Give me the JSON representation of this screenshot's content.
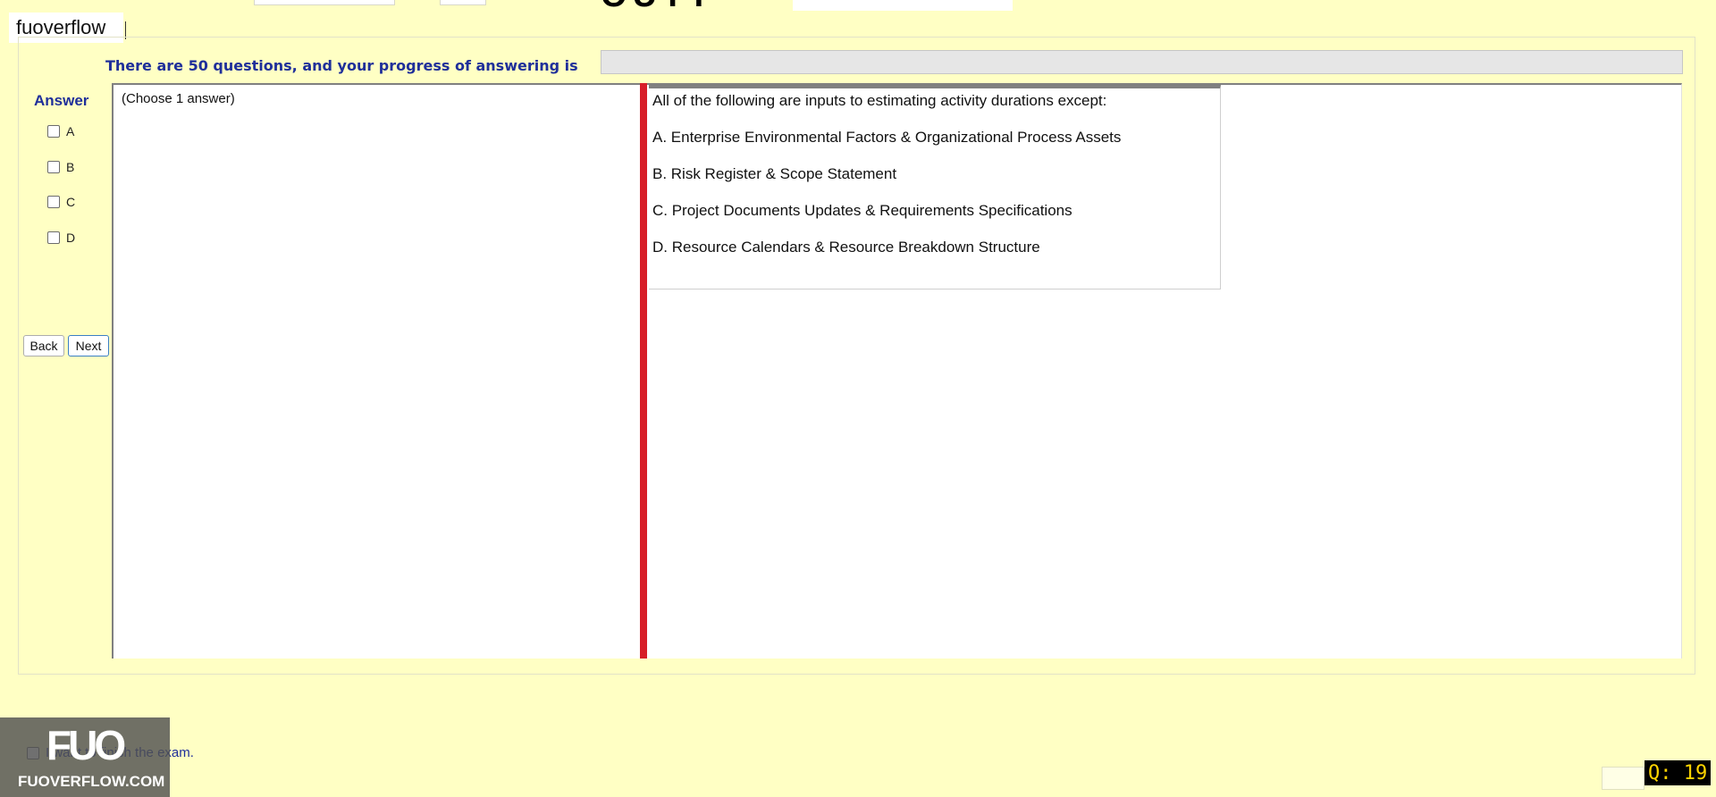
{
  "brand": {
    "name": "fuoverflow"
  },
  "header": {
    "title_fragment": "OUTT"
  },
  "progress": {
    "label": "There are 50 questions, and your progress of answering is",
    "fraction": 0
  },
  "answer_panel": {
    "heading": "Answer",
    "options": [
      "A",
      "B",
      "C",
      "D"
    ]
  },
  "navigation": {
    "back_label": "Back",
    "next_label": "Next"
  },
  "left_pane": {
    "instruction": "(Choose 1 answer)"
  },
  "question": {
    "stem": "All of the following are inputs to estimating activity durations except:",
    "choices": [
      "A.  Enterprise Environmental Factors & Organizational Process Assets",
      "B.  Risk Register & Scope Statement",
      "C.  Project Documents Updates & Requirements Specifications",
      "D.  Resource Calendars & Resource Breakdown Structure"
    ]
  },
  "finish": {
    "label": "I want to finish the exam."
  },
  "watermark": {
    "logo": "FUO",
    "site": "FUOVERFLOW.COM"
  },
  "counter": {
    "label": "Q: 19"
  },
  "colors": {
    "background": "#ffffc4",
    "heading_blue": "#1f2f9a",
    "splitter_red": "#d71e28",
    "counter_text": "#ffd400"
  }
}
